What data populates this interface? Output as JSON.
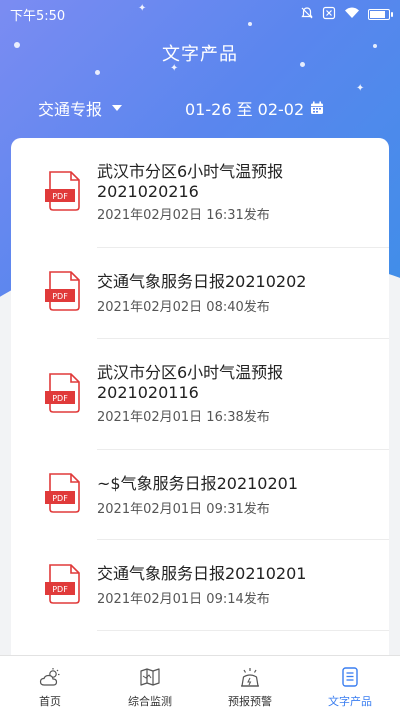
{
  "status_bar": {
    "time": "下午5:50",
    "icons": [
      "bell-off-icon",
      "sim-x-icon",
      "wifi-icon",
      "battery-icon"
    ]
  },
  "header": {
    "title": "文字产品"
  },
  "filter": {
    "type_label": "交通专报",
    "date_range": "01-26 至 02-02"
  },
  "list": {
    "items": [
      {
        "title": "武汉市分区6小时气温预报2021020216",
        "time": "2021年02月02日 16:31发布",
        "icon": "pdf-icon",
        "icon_label": "PDF"
      },
      {
        "title": "交通气象服务日报20210202",
        "time": "2021年02月02日 08:40发布",
        "icon": "pdf-icon",
        "icon_label": "PDF"
      },
      {
        "title": "武汉市分区6小时气温预报2021020116",
        "time": "2021年02月01日 16:38发布",
        "icon": "pdf-icon",
        "icon_label": "PDF"
      },
      {
        "title": "~$气象服务日报20210201",
        "time": "2021年02月01日 09:31发布",
        "icon": "pdf-icon",
        "icon_label": "PDF"
      },
      {
        "title": "交通气象服务日报20210201",
        "time": "2021年02月01日 09:14发布",
        "icon": "pdf-icon",
        "icon_label": "PDF"
      }
    ]
  },
  "tabbar": {
    "tabs": [
      {
        "label": "首页",
        "icon": "weather-icon",
        "active": false
      },
      {
        "label": "综合监测",
        "icon": "map-icon",
        "active": false
      },
      {
        "label": "预报预警",
        "icon": "forecast-icon",
        "active": false
      },
      {
        "label": "文字产品",
        "icon": "document-icon",
        "active": true
      }
    ]
  },
  "colors": {
    "accent": "#3a7ef0",
    "pdf_red": "#e03a3a",
    "header_gradient_start": "#7b8cf2",
    "header_gradient_end": "#3d8fe8"
  }
}
